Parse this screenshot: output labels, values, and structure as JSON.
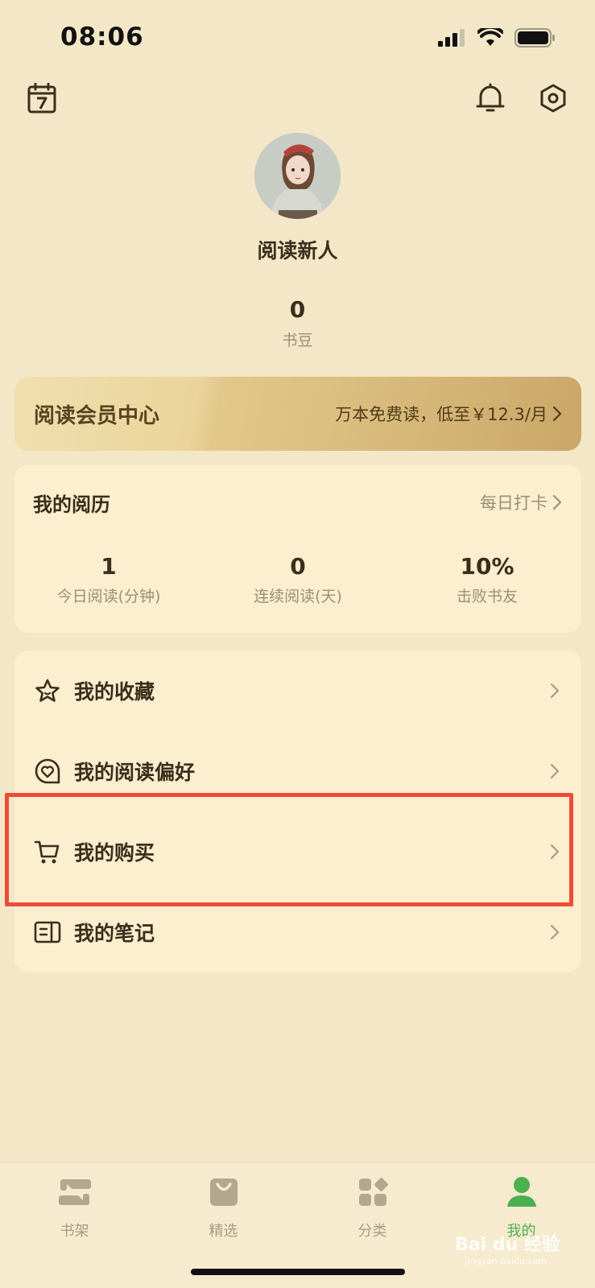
{
  "status_bar": {
    "time": "08:06"
  },
  "profile": {
    "username": "阅读新人",
    "beans_value": "0",
    "beans_label": "书豆"
  },
  "vip": {
    "title": "阅读会员中心",
    "promo": "万本免费读，低至￥12.3/月"
  },
  "history": {
    "title": "我的阅历",
    "checkin": "每日打卡",
    "stats": [
      {
        "value": "1",
        "label": "今日阅读(分钟)"
      },
      {
        "value": "0",
        "label": "连续阅读(天)"
      },
      {
        "value": "10%",
        "label": "击败书友"
      }
    ]
  },
  "menu": [
    {
      "label": "我的收藏",
      "icon": "star-icon"
    },
    {
      "label": "我的阅读偏好",
      "icon": "heart-icon"
    },
    {
      "label": "我的购买",
      "icon": "cart-icon"
    },
    {
      "label": "我的笔记",
      "icon": "notebook-icon"
    }
  ],
  "tabs": [
    {
      "label": "书架",
      "icon": "bookshelf-icon"
    },
    {
      "label": "精选",
      "icon": "bag-icon"
    },
    {
      "label": "分类",
      "icon": "grid-icon"
    },
    {
      "label": "我的",
      "icon": "user-icon",
      "active": true
    }
  ],
  "colors": {
    "background": "#f3e7c8",
    "card": "#fbefcf",
    "accent_active": "#4caf50",
    "highlight": "#ef4b3a"
  },
  "watermark": {
    "text": "Bai du 经验",
    "sub": "jingyan.baidu.com"
  }
}
